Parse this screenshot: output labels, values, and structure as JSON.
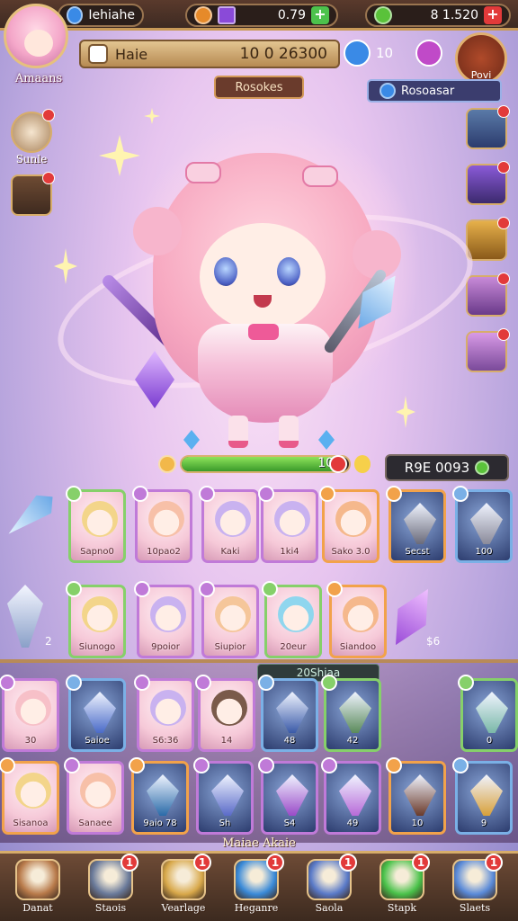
{
  "top_bar": {
    "left_value": "Iehiahe",
    "mid_value": "0.79",
    "right_value": "8 1.520"
  },
  "profile": {
    "name": "Amaans"
  },
  "name_bar": {
    "label": "Haie",
    "value": "10 0 26300",
    "badge_value": "10"
  },
  "chest": {
    "label": "Povi"
  },
  "tags": {
    "resource": "Rosokes",
    "bonus": "Rosoasar"
  },
  "left_side": {
    "button_label": "Sunle"
  },
  "hero": {
    "progress_label": "100",
    "progress_fraction": 0.95
  },
  "power": {
    "label": "R9E 0093"
  },
  "cards_row1": [
    {
      "label": "Sapno0",
      "face": "#f3d58a",
      "border": "#86d06a"
    },
    {
      "label": "10pao2",
      "face": "#f7c0a8",
      "border": "#c07ad8"
    },
    {
      "label": "Kaki",
      "face": "#c9b2f0",
      "border": "#c07ad8"
    },
    {
      "label": "1ki4",
      "face": "#c9b2f0",
      "border": "#c07ad8"
    },
    {
      "label": "Sako 3.0",
      "face": "#f5b88c",
      "border": "#f2a24a"
    },
    {
      "label": "Secst",
      "face": "#6a6a7a",
      "border": "#f2a24a"
    },
    {
      "label": "100",
      "face": "#8a8a9a",
      "border": "#7ab0e6"
    }
  ],
  "cards_row2": [
    {
      "label": "Siunogo",
      "face": "#f3d58a",
      "border": "#86d06a"
    },
    {
      "label": "9poior",
      "face": "#c9b2f0",
      "border": "#c07ad8"
    },
    {
      "label": "Siupior",
      "face": "#f5c69a",
      "border": "#c07ad8"
    },
    {
      "label": "20eur",
      "face": "#8fd6ee",
      "border": "#86d06a"
    },
    {
      "label": "Siandoo",
      "face": "#f5b88c",
      "border": "#f2a24a"
    }
  ],
  "row2_side": {
    "left_value": "2",
    "right_value": "$6"
  },
  "section_tag": "20Shiaa",
  "cards_row3": [
    {
      "label": "30",
      "face": "#f7c0c8",
      "border": "#c07ad8"
    },
    {
      "label": "Saioe",
      "face": "#4a6ac8",
      "border": "#7ab0e6"
    },
    {
      "label": "S6:36",
      "face": "#c9b2f0",
      "border": "#c07ad8"
    },
    {
      "label": "14",
      "face": "#7a5a4a",
      "border": "#c07ad8"
    },
    {
      "label": "48",
      "face": "#3a5aa8",
      "border": "#7ab0e6"
    },
    {
      "label": "42",
      "face": "#5a8a5a",
      "border": "#86d06a"
    },
    {
      "label": "0",
      "face": "#7ab8a8",
      "border": "#86d06a"
    }
  ],
  "cards_row4": [
    {
      "label": "Sisanoa",
      "face": "#f3d58a",
      "border": "#f2a24a"
    },
    {
      "label": "Sanaee",
      "face": "#f7c0a8",
      "border": "#c07ad8"
    },
    {
      "label": "9aio 78",
      "face": "#2a6aa8",
      "border": "#f2a24a"
    },
    {
      "label": "Sh",
      "face": "#5a6ac8",
      "border": "#c07ad8"
    },
    {
      "label": "S4",
      "face": "#9a4ac8",
      "border": "#c07ad8"
    },
    {
      "label": "49",
      "face": "#b86ad8",
      "border": "#c07ad8"
    },
    {
      "label": "10",
      "face": "#6a3a2a",
      "border": "#f2a24a"
    },
    {
      "label": "9",
      "face": "#d8a03a",
      "border": "#7ab0e6"
    }
  ],
  "bottom_title": "Maiae Akaie",
  "nav": [
    {
      "label": "Danat",
      "badge": ""
    },
    {
      "label": "Staois",
      "badge": "1"
    },
    {
      "label": "Vearlage",
      "badge": "1"
    },
    {
      "label": "Heganre",
      "badge": "1"
    },
    {
      "label": "Saola",
      "badge": "1"
    },
    {
      "label": "Stapk",
      "badge": "1"
    },
    {
      "label": "Slaets",
      "badge": "1"
    }
  ],
  "colors": {
    "accent_gold": "#d7ad6a",
    "badge_red": "#e23a3a",
    "hp_green": "#5ac23a"
  }
}
